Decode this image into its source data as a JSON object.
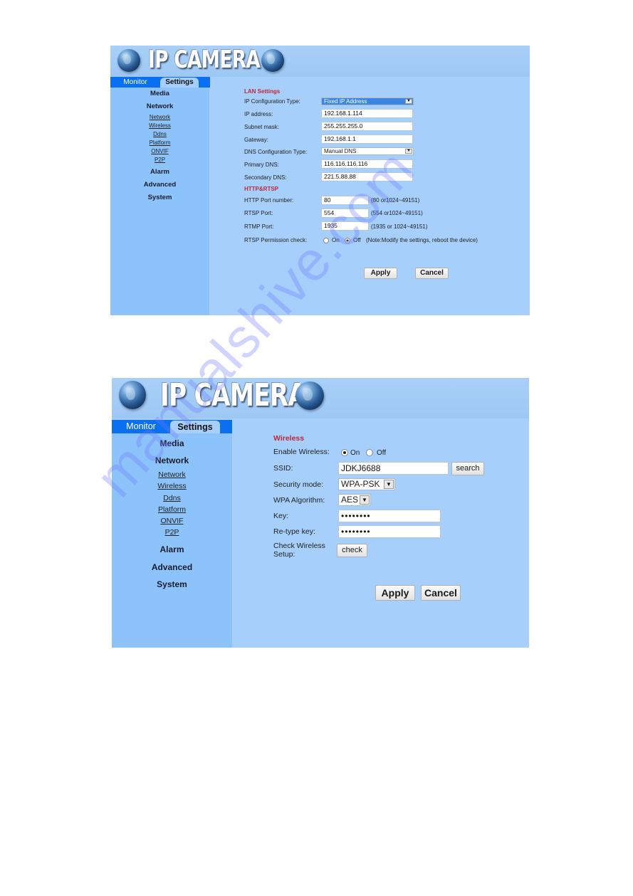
{
  "screens": [
    {
      "logo_text": "IP CAMERA",
      "tabs": [
        "Monitor",
        "Settings"
      ],
      "active_tab": "Settings",
      "sidebar": {
        "media": "Media",
        "network": "Network",
        "network_links": [
          "Network",
          "Wireless",
          "Ddns",
          "Platform",
          "ONVIF",
          "P2P"
        ],
        "alarm": "Alarm",
        "advanced": "Advanced",
        "system": "System"
      },
      "lan": {
        "section_title": "LAN Settings",
        "ip_config_type_label": "IP Configuration Type:",
        "ip_config_type_value": "Fixed IP Address",
        "ip_address_label": "IP address:",
        "ip_address_value": "192.168.1.114",
        "subnet_mask_label": "Subnet mask:",
        "subnet_mask_value": "255.255.255.0",
        "gateway_label": "Gateway:",
        "gateway_value": "192.168.1.1",
        "dns_config_type_label": "DNS Configuration Type:",
        "dns_config_type_value": "Manual DNS",
        "primary_dns_label": "Primary DNS:",
        "primary_dns_value": "116.116.116.116",
        "secondary_dns_label": "Secondary DNS:",
        "secondary_dns_value": "221.5.88.88"
      },
      "http_rtsp": {
        "section_title": "HTTP&RTSP",
        "http_port_label": "HTTP Port number:",
        "http_port_value": "80",
        "http_port_hint": "(80 or1024~49151)",
        "rtsp_port_label": "RTSP Port:",
        "rtsp_port_value": "554",
        "rtsp_port_hint": "(554 or1024~49151)",
        "rtmp_port_label": "RTMP Port:",
        "rtmp_port_value": "1935",
        "rtmp_port_hint": "(1935 or 1024~49151)",
        "rtsp_permission_label": "RTSP Permission check:",
        "rtsp_permission_on": "On",
        "rtsp_permission_off": "Off",
        "rtsp_permission_selected": "Off",
        "rtsp_permission_note": "(Note:Modify the settings, reboot the device)"
      },
      "buttons": {
        "apply": "Apply",
        "cancel": "Cancel"
      }
    },
    {
      "logo_text": "IP CAMERA",
      "tabs": [
        "Monitor",
        "Settings"
      ],
      "active_tab": "Settings",
      "sidebar": {
        "media": "Media",
        "network": "Network",
        "network_links": [
          "Network",
          "Wireless",
          "Ddns",
          "Platform",
          "ONVIF",
          "P2P"
        ],
        "alarm": "Alarm",
        "advanced": "Advanced",
        "system": "System"
      },
      "wireless": {
        "section_title": "Wireless",
        "enable_label": "Enable Wireless:",
        "enable_on": "On",
        "enable_off": "Off",
        "enable_selected": "On",
        "ssid_label": "SSID:",
        "ssid_value": "JDKJ6688",
        "search_button": "search",
        "security_mode_label": "Security mode:",
        "security_mode_value": "WPA-PSK",
        "wpa_algorithm_label": "WPA Algorithm:",
        "wpa_algorithm_value": "AES",
        "key_label": "Key:",
        "key_value": "••••••••",
        "retype_key_label": "Re-type key:",
        "retype_key_value": "••••••••",
        "check_label_line1": "Check Wireless",
        "check_label_line2": "Setup:",
        "check_button": "check"
      },
      "buttons": {
        "apply": "Apply",
        "cancel": "Cancel"
      }
    }
  ],
  "watermark": "manualshive.com",
  "colors": {
    "panel_bg": "#a6cffb",
    "sidebar_bg": "#8cc3fa",
    "tab_bar": "#0a6ff0",
    "section_title": "#c0273a"
  }
}
